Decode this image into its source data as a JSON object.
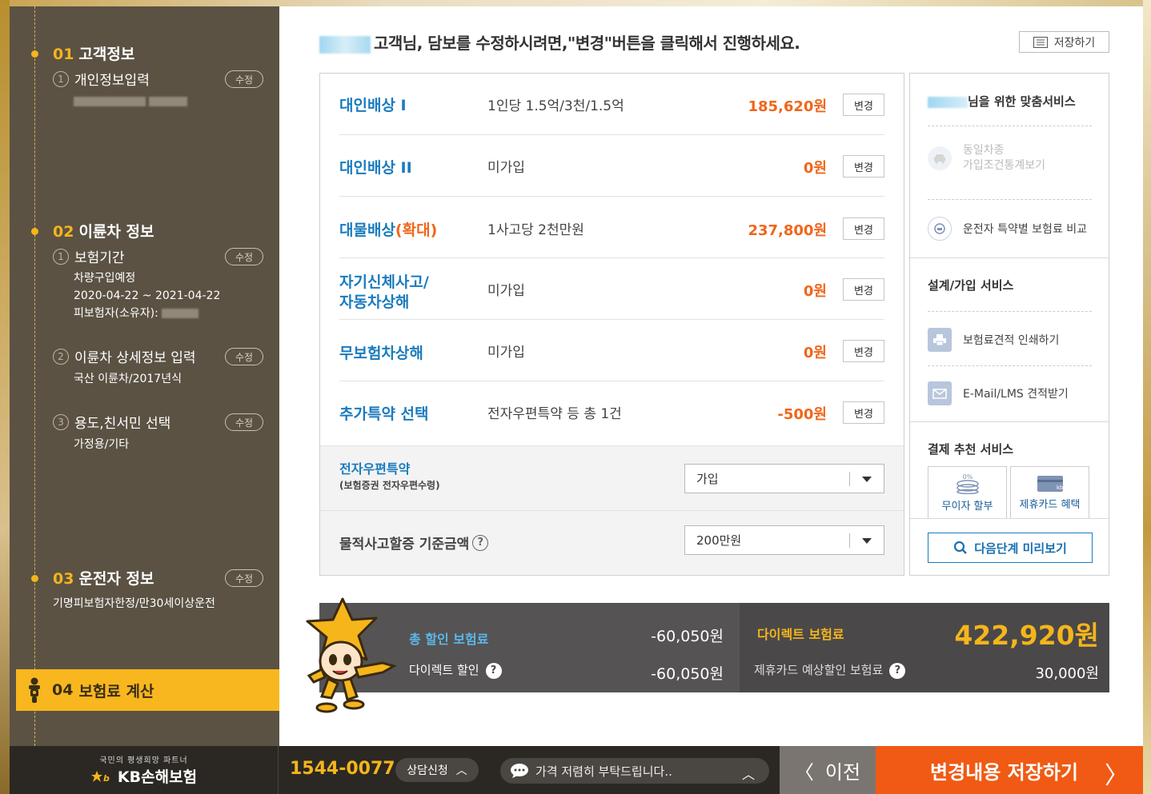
{
  "sidebar": {
    "steps": [
      {
        "num": "01",
        "title": "고객정보",
        "subs": [
          {
            "n": "1",
            "label": "개인정보입력",
            "edit": "수정"
          }
        ]
      },
      {
        "num": "02",
        "title": "이륜차 정보",
        "subs": [
          {
            "n": "1",
            "label": "보험기간",
            "edit": "수정",
            "info": [
              "차량구입예정",
              "2020-04-22 ~ 2021-04-22",
              "피보험자(소유자):"
            ]
          },
          {
            "n": "2",
            "label": "이륜차 상세정보 입력",
            "edit": "수정",
            "info": [
              "국산 이륜차/2017년식"
            ]
          },
          {
            "n": "3",
            "label": "용도,친서민 선택",
            "edit": "수정",
            "info": [
              "가정용/기타"
            ]
          }
        ]
      },
      {
        "num": "03",
        "title": "운전자 정보",
        "edit": "수정",
        "info": "기명피보험자한정/만30세이상운전"
      },
      {
        "num": "04",
        "title": "보험료 계산"
      }
    ]
  },
  "main": {
    "headline": "고객님, 담보를 수정하시려면,\"변경\"버튼을 클릭해서 진행하세요.",
    "save_label": "저장하기",
    "coverages": [
      {
        "name": "대인배상 I",
        "desc": "1인당 1.5억/3천/1.5억",
        "price": "185,620원",
        "btn": "변경"
      },
      {
        "name": "대인배상 II",
        "desc": "미가입",
        "price": "0원",
        "btn": "변경"
      },
      {
        "name": "대물배상",
        "name_suffix": "(확대)",
        "desc": "1사고당 2천만원",
        "price": "237,800원",
        "btn": "변경"
      },
      {
        "name": "자기신체사고/",
        "name2": "자동차상해",
        "desc": "미가입",
        "price": "0원",
        "btn": "변경"
      },
      {
        "name": "무보험차상해",
        "desc": "미가입",
        "price": "0원",
        "btn": "변경"
      },
      {
        "name": "추가특약 선택",
        "desc": "전자우편특약 등 총 1건",
        "price": "-500원",
        "btn": "변경"
      }
    ],
    "option1": {
      "label": "전자우편특약",
      "sublabel": "(보험증권 전자우편수령)",
      "selected": "가입"
    },
    "option2": {
      "label": "물적사고할증 기준금액",
      "selected": "200만원"
    }
  },
  "services": {
    "title_suffix": "님을 위한 맞춤서비스",
    "items": [
      {
        "label1": "동일차종",
        "label2": "가입조건통계보기",
        "icon": "car-icon"
      },
      {
        "label": "운전자 특약별 보험료 비교",
        "icon": "compare-icon"
      }
    ],
    "design_title": "설계/가입 서비스",
    "design_items": [
      {
        "label": "보험료견적 인쇄하기",
        "icon": "printer-icon"
      },
      {
        "label": "E-Mail/LMS 견적받기",
        "icon": "mail-icon"
      }
    ],
    "pay_title": "결제 추천 서비스",
    "pay_items": [
      {
        "label": "무이자 할부",
        "icon": "installment-icon",
        "badge": "0%"
      },
      {
        "label": "제휴카드 혜택",
        "icon": "card-icon"
      }
    ],
    "preview_label": "다음단계 미리보기"
  },
  "summary": {
    "total_discount_label": "총 할인 보험료",
    "total_discount_value": "-60,050원",
    "direct_discount_label": "다이렉트 할인",
    "direct_discount_value": "-60,050원",
    "direct_premium_label": "다이렉트 보험료",
    "direct_premium_value": "422,920원",
    "card_discount_label": "제휴카드 예상할인 보험료",
    "card_discount_value": "30,000원"
  },
  "footer": {
    "slogan": "국민의 평생희망 파트너",
    "brand": "KB손해보험",
    "phone": "1544-0077",
    "consult": "상담신청",
    "chat": "가격 저렴히 부탁드립니다..",
    "prev": "이전",
    "save": "변경내용 저장하기"
  },
  "colors": {
    "accent": "#f5b51b",
    "blue": "#1a7bbf",
    "orange": "#f0661a",
    "save_btn": "#f05a14"
  }
}
